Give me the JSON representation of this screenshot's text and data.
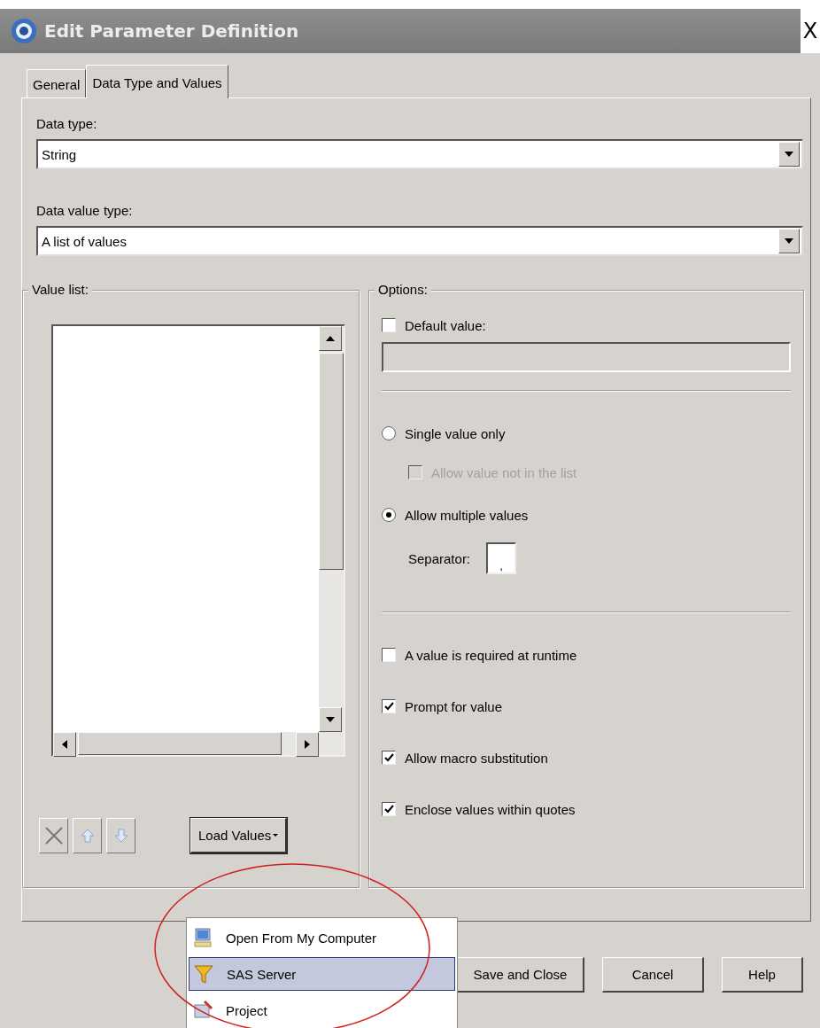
{
  "window": {
    "title": "Edit Parameter Definition",
    "close": "X"
  },
  "tabs": [
    {
      "label": "General",
      "selected": false
    },
    {
      "label": "Data Type and Values",
      "selected": true
    }
  ],
  "data_type": {
    "label": "Data type:",
    "value": "String"
  },
  "data_value_type": {
    "label": "Data value type:",
    "value": "A list of values"
  },
  "value_list": {
    "label": "Value list:",
    "load_button": "Load Values"
  },
  "options": {
    "label": "Options:",
    "items": [
      {
        "kind": "checkbox",
        "label": "Default value:",
        "checked": false,
        "disabled": false
      },
      {
        "kind": "field",
        "disabled": true
      },
      {
        "kind": "divider"
      },
      {
        "kind": "radio",
        "label": "Single value only",
        "selected": false,
        "children": [
          {
            "kind": "checkbox",
            "label": "Allow value not in the list",
            "checked": false,
            "disabled": true
          }
        ]
      },
      {
        "kind": "radio",
        "label": "Allow multiple values",
        "selected": true,
        "children": [
          {
            "kind": "separator",
            "label": "Separator:",
            "value": ","
          }
        ]
      },
      {
        "kind": "divider"
      },
      {
        "kind": "checkbox",
        "label": "A value is required at runtime",
        "checked": false,
        "disabled": false
      },
      {
        "kind": "checkbox",
        "label": "Prompt for value",
        "checked": true,
        "disabled": false
      },
      {
        "kind": "checkbox",
        "label": "Allow macro substitution",
        "checked": true,
        "disabled": false
      },
      {
        "kind": "checkbox",
        "label": "Enclose values within quotes",
        "checked": true,
        "disabled": false
      }
    ]
  },
  "menu": {
    "items": [
      {
        "label": "Open From My Computer",
        "selected": false
      },
      {
        "label": "SAS Server",
        "selected": true
      },
      {
        "label": "Project",
        "selected": false
      }
    ]
  },
  "buttons": [
    {
      "label": "Save and Close"
    },
    {
      "label": "Cancel"
    },
    {
      "label": "Help"
    }
  ],
  "annotation": {
    "kind": "ellipse"
  }
}
